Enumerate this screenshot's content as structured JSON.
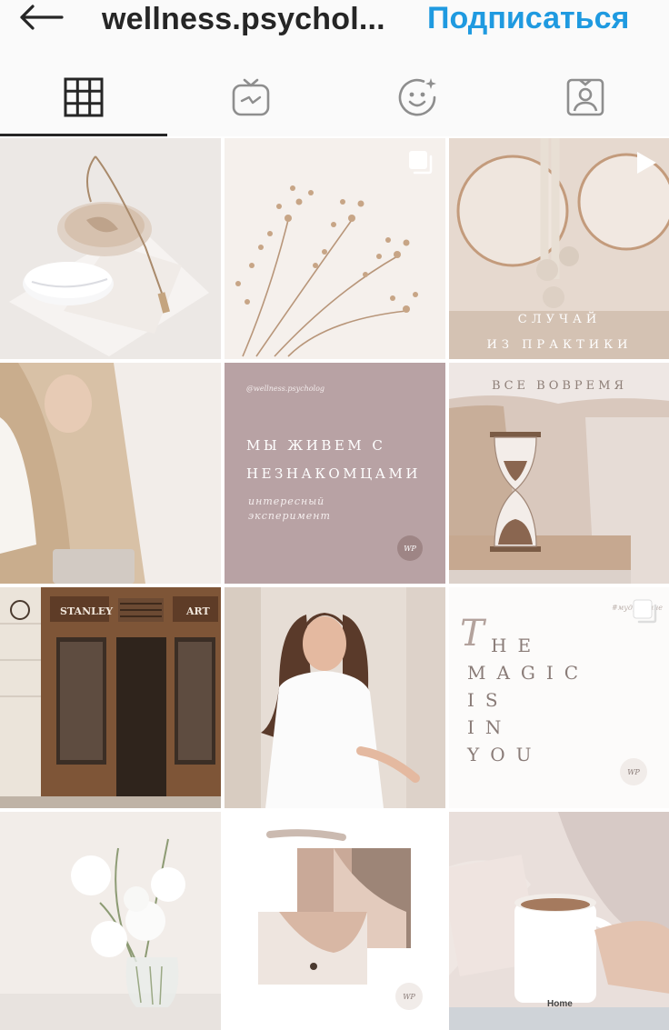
{
  "header": {
    "back_icon": "arrow-left-icon",
    "username": "wellness.psychol...",
    "follow_label": "Подписаться",
    "accent_color": "#1f9ae0"
  },
  "tabs": [
    {
      "icon": "grid-icon",
      "active": true
    },
    {
      "icon": "igtv-icon",
      "active": false
    },
    {
      "icon": "effects-face-icon",
      "active": false
    },
    {
      "icon": "tagged-person-icon",
      "active": false
    }
  ],
  "posts": [
    {
      "desc_icon": "mouse-and-necklace-photo"
    },
    {
      "desc_icon": "dried-flowers-photo",
      "badge": "carousel-icon"
    },
    {
      "desc_icon": "mirrors-photo",
      "badge": "play-icon",
      "caption_line1": "СЛУЧАЙ",
      "caption_line2": "ИЗ ПРАКТИКИ"
    },
    {
      "desc_icon": "beige-coat-photo"
    },
    {
      "handle": "@wellness.psycholog",
      "line1": "МЫ ЖИВЕМ С",
      "line2": "НЕЗНАКОМЦАМИ",
      "sub1": "интересный",
      "sub2": "эксперимент",
      "logo": "WP"
    },
    {
      "caption": "ВСЕ ВОВРЕМЯ",
      "desc_icon": "hourglass-photo"
    },
    {
      "desc_icon": "shop-front-photo",
      "sign1": "STANLEY",
      "sign2": "ART"
    },
    {
      "desc_icon": "woman-portrait-photo"
    },
    {
      "tag": "#мудрыемне",
      "badge": "carousel-icon",
      "big_letter": "T",
      "w1": "HE",
      "w2": "MAGIC",
      "w3": "IS",
      "w4": "IN",
      "w5": "YOU",
      "logo": "WP"
    },
    {
      "desc_icon": "white-flowers-vase-photo"
    },
    {
      "desc_icon": "neck-collage-photo",
      "logo": "WP"
    },
    {
      "desc_icon": "coffee-mug-photo",
      "mug_text": "Home"
    }
  ]
}
